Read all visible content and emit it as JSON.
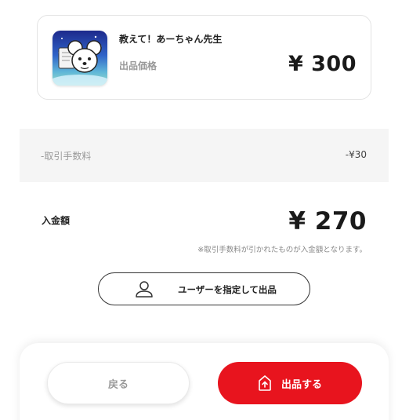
{
  "product": {
    "title": "教えて！あーちゃん先生",
    "price_label": "出品価格",
    "price": "¥ 300",
    "thumbnail_icon": "mouse-character-thumbnail"
  },
  "fee": {
    "label": "-取引手数料",
    "value": "-¥30"
  },
  "deposit": {
    "label": "入金額",
    "value": "¥ 270",
    "note": "※取引手数料が引かれたものが入金額となります。"
  },
  "user_button": {
    "label": "ユーザーを指定して出品",
    "icon": "person-icon"
  },
  "actions": {
    "back_label": "戻る",
    "list_label": "出品する",
    "list_icon": "upload-tag-icon"
  },
  "colors": {
    "accent": "#e8141e",
    "muted_text": "#999999",
    "fee_background": "#f5f5f5"
  }
}
